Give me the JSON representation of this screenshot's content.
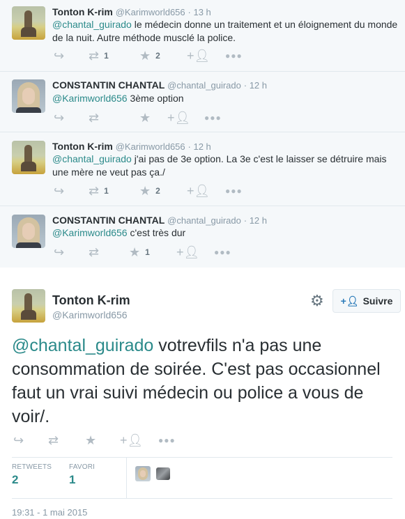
{
  "replies": [
    {
      "name": "Tonton K-rim",
      "handle": "@Karimworld656",
      "time": "· 13 h",
      "text_lines": [
        {
          "mention": "@chantal_guirado",
          "rest": " le médecin donne un traitement et un éloignement du monde"
        },
        {
          "mention": "",
          "rest": "de la nuit. Autre méthode musclé la police."
        }
      ],
      "retweets": "1",
      "favorites": "2"
    },
    {
      "name": "CONSTANTIN CHANTAL",
      "handle": "@chantal_guirado",
      "time": "· 12 h",
      "text_lines": [
        {
          "mention": "@Karimworld656",
          "rest": " 3ème option"
        }
      ],
      "retweets": "",
      "favorites": ""
    },
    {
      "name": "Tonton K-rim",
      "handle": "@Karimworld656",
      "time": "· 12 h",
      "text_lines": [
        {
          "mention": "@chantal_guirado",
          "rest": " j'ai pas de 3e option. La 3e c'est le laisser se détruire mais"
        },
        {
          "mention": "",
          "rest": "une mère ne veut pas ça./"
        }
      ],
      "retweets": "1",
      "favorites": "2"
    },
    {
      "name": "CONSTANTIN CHANTAL",
      "handle": "@chantal_guirado",
      "time": "· 12 h",
      "text_lines": [
        {
          "mention": "@Karimworld656",
          "rest": " c'est très dur"
        }
      ],
      "retweets": "",
      "favorites": "1"
    }
  ],
  "main_tweet": {
    "name": "Tonton K-rim",
    "handle": "@Karimworld656",
    "follow_label": "Suivre",
    "mention": "@chantal_guirado",
    "text": " votrevfils n'a pas une consommation de soirée. C'est pas occasionnel faut un vrai suivi médecin ou police a vous de voir/.",
    "retweets_label": "RETWEETS",
    "retweets_count": "2",
    "favorites_label": "FAVORI",
    "favorites_count": "1",
    "timestamp": "19:31 - 1 mai 2015"
  },
  "icons": {
    "reply": "reply-icon",
    "retweet": "retweet-icon",
    "favorite": "star-icon",
    "follow": "add-user-icon",
    "more": "more-icon",
    "settings": "gear-icon"
  },
  "colors": {
    "link": "#2b8a8a",
    "meta": "#8899a6",
    "thread_bg": "#f5f8fa",
    "follow_icon": "#2b7bb9"
  }
}
